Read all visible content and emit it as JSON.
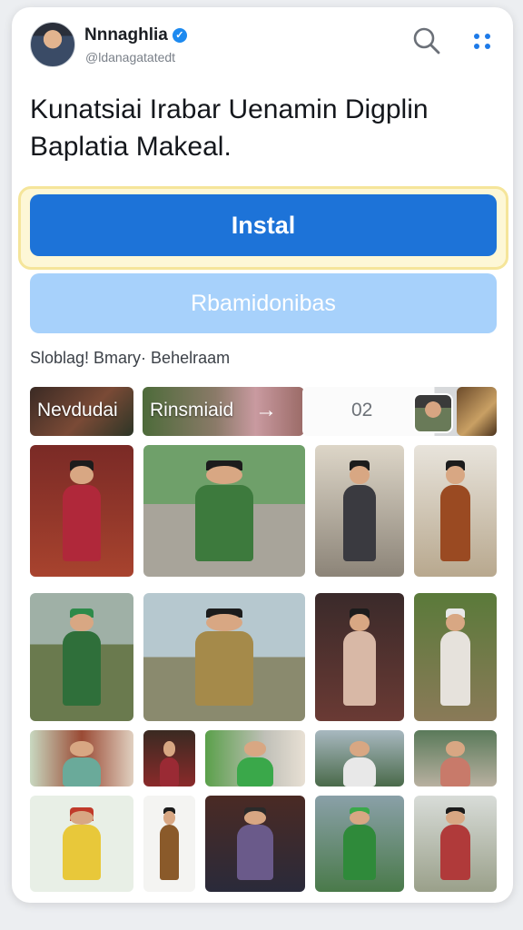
{
  "header": {
    "name": "Nnnaghlia",
    "handle": "@ldanagatatedt",
    "verified_mark": "✓"
  },
  "title": "Kunatsiai Irabar Uenamin Digplin Baplatia Makeal.",
  "buttons": {
    "install_label": "Instal",
    "secondary_label": "Rbamidonibas"
  },
  "section_label": "Sloblag! Bmary· Behelraam",
  "chips": [
    {
      "label": "Nevdudai"
    },
    {
      "label": "Rinsmiaid"
    },
    {
      "label": "02"
    }
  ],
  "icons": {
    "search": "search-icon",
    "menu": "dots-icon",
    "arrow": "→"
  },
  "colors": {
    "accent": "#1d73d8",
    "secondary": "#a7d1fb",
    "verified": "#1d8af0",
    "highlight": "#fdf7d6"
  }
}
